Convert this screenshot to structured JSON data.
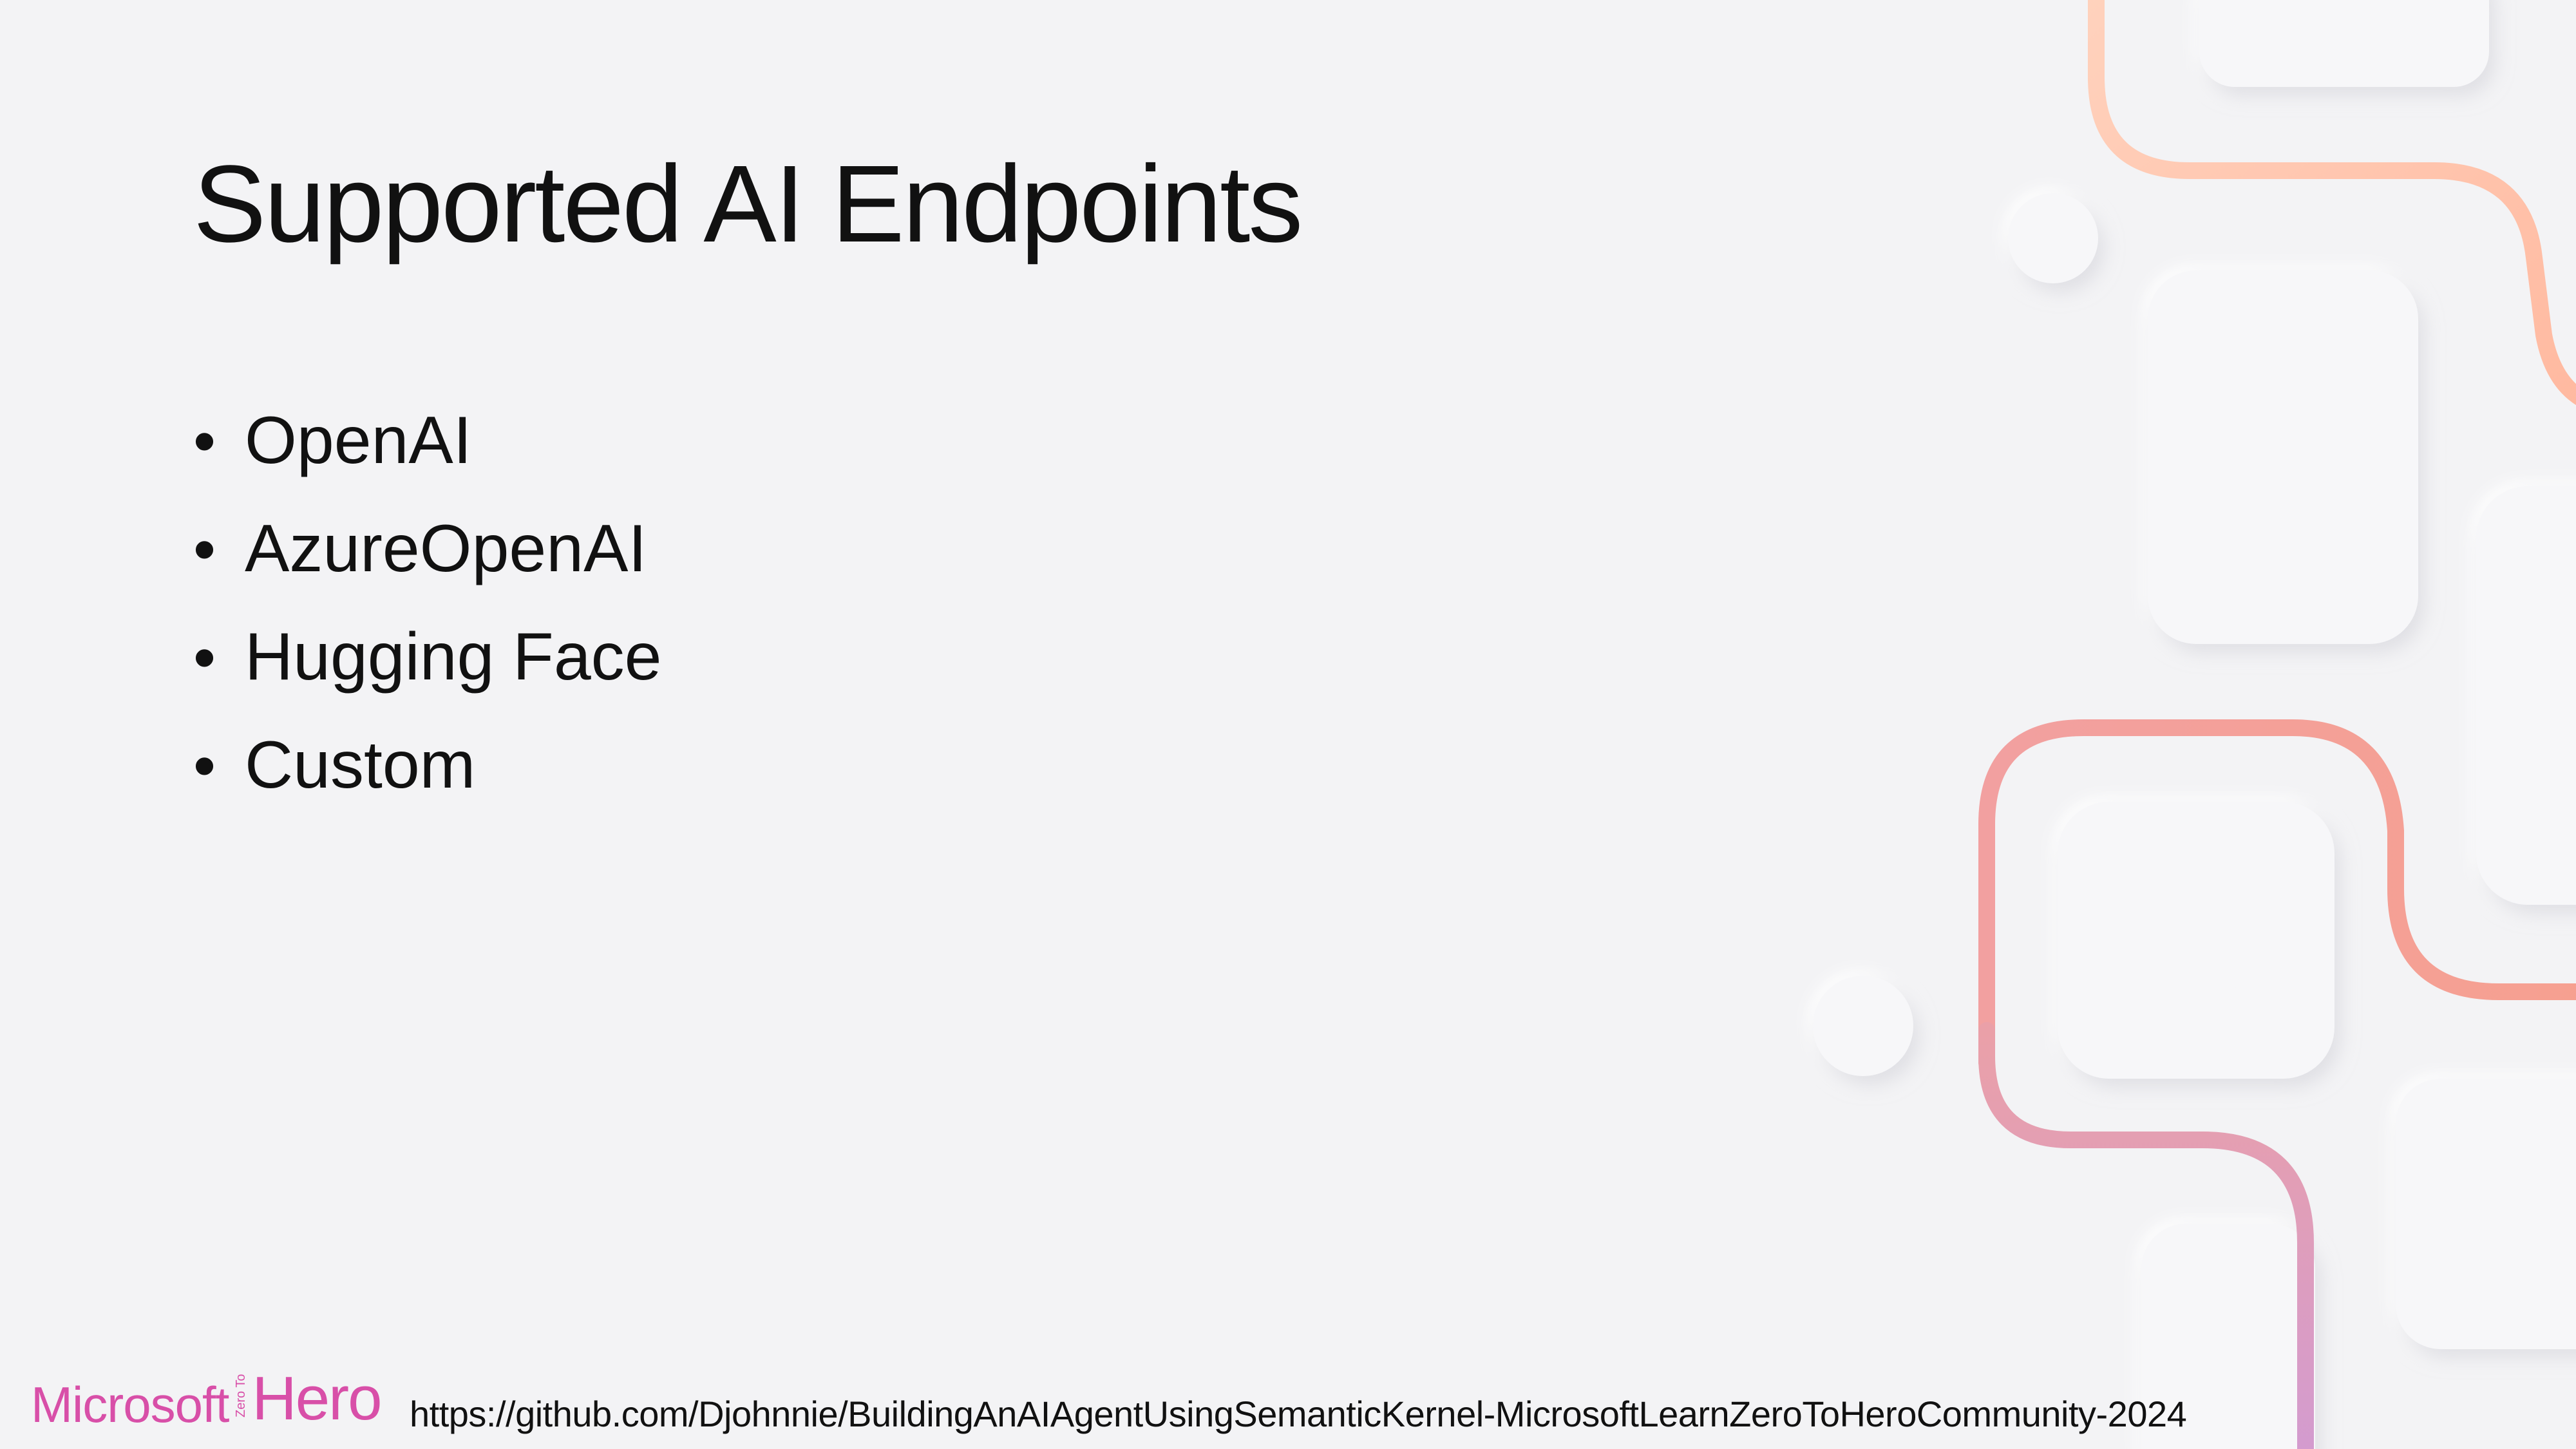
{
  "slide": {
    "title": "Supported AI Endpoints",
    "bullets": [
      "OpenAI",
      "AzureOpenAI",
      "Hugging Face",
      "Custom"
    ],
    "bullet_symbol": "•",
    "footer_url": "https://github.com/Djohnnie/BuildingAnAIAgentUsingSemanticKernel-MicrosoftLearnZeroToHeroCommunity-2024",
    "logo": {
      "word": "Microsoft",
      "small": "Zero To",
      "hero": "Hero"
    }
  },
  "colors": {
    "background": "#f3f3f5",
    "text": "#111111",
    "logo": "#d84fa8",
    "stroke_peach": "#ffc0a8",
    "stroke_coral": "#f4a196",
    "stroke_mauve": "#d79bc8"
  }
}
